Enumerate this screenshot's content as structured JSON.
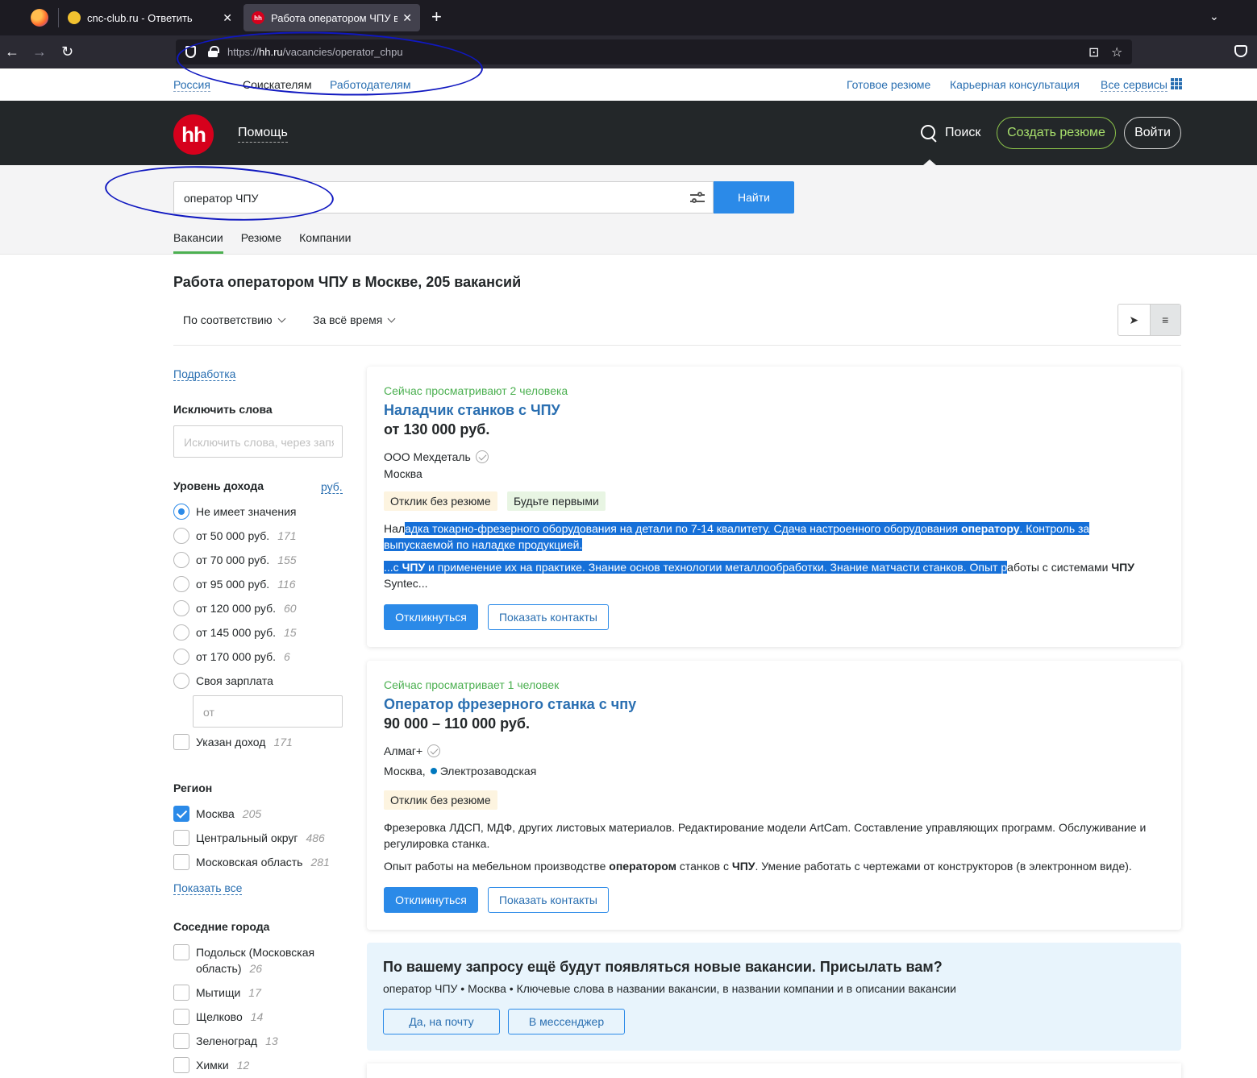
{
  "browser": {
    "tabs": [
      {
        "title": "cnc-club.ru - Ответить",
        "favicon_color": "#f2c230"
      },
      {
        "title": "Работа оператором ЧПУ в Мо",
        "favicon_color": "#d6001c",
        "favicon_text": "hh"
      }
    ],
    "url_scheme": "https://",
    "url_host": "hh.ru",
    "url_path": "/vacancies/operator_chpu"
  },
  "toplinks": {
    "region": "Россия",
    "seekers": "Соискателям",
    "employers": "Работодателям",
    "ready_resume": "Готовое резюме",
    "career": "Карьерная консультация",
    "all_services": "Все сервисы"
  },
  "header": {
    "logo": "hh",
    "help": "Помощь",
    "search": "Поиск",
    "create_resume": "Создать резюме",
    "login": "Войти"
  },
  "search": {
    "query": "оператор ЧПУ",
    "find": "Найти",
    "tabs": [
      "Вакансии",
      "Резюме",
      "Компании"
    ]
  },
  "results": {
    "title": "Работа оператором ЧПУ в Москве, 205 вакансий",
    "sort": "По соответствию",
    "period": "За всё время"
  },
  "sidebar": {
    "podrabotka": "Подработка",
    "exclude_title": "Исключить слова",
    "exclude_placeholder": "Исключить слова, через запятую",
    "income_title": "Уровень дохода",
    "currency": "руб.",
    "income_options": [
      {
        "label": "Не имеет значения",
        "count": ""
      },
      {
        "label": "от 50 000 руб.",
        "count": "171"
      },
      {
        "label": "от 70 000 руб.",
        "count": "155"
      },
      {
        "label": "от 95 000 руб.",
        "count": "116"
      },
      {
        "label": "от 120 000 руб.",
        "count": "60"
      },
      {
        "label": "от 145 000 руб.",
        "count": "15"
      },
      {
        "label": "от 170 000 руб.",
        "count": "6"
      },
      {
        "label": "Своя зарплата",
        "count": ""
      }
    ],
    "own_salary_placeholder": "от",
    "income_specified": {
      "label": "Указан доход",
      "count": "171"
    },
    "region_title": "Регион",
    "regions": [
      {
        "label": "Москва",
        "count": "205"
      },
      {
        "label": "Центральный округ",
        "count": "486"
      },
      {
        "label": "Московская область",
        "count": "281"
      }
    ],
    "show_all": "Показать все",
    "nearby_title": "Соседние города",
    "nearby": [
      {
        "label_line1": "Подольск (Московская",
        "label_line2": "область)",
        "count": "26"
      },
      {
        "label": "Мытищи",
        "count": "17"
      },
      {
        "label": "Щелково",
        "count": "14"
      },
      {
        "label": "Зеленоград",
        "count": "13"
      },
      {
        "label": "Химки",
        "count": "12"
      }
    ]
  },
  "vacancies": [
    {
      "viewing": "Сейчас просматривают 2 человека",
      "title": "Наладчик станков с ЧПУ",
      "salary": "от 130 000 руб.",
      "company": "ООО Мехдеталь",
      "city": "Москва",
      "tags": [
        "Отклик без резюме",
        "Будьте первыми"
      ],
      "snippet1": {
        "a": "Нал",
        "b": "адка токарно-фрезерного оборудования на детали по 7-14 квалитету. Сдача настроенного оборудования ",
        "c": "оператору",
        "d": ". Контроль за ",
        "e": "выпускаемой по наладке продукцией."
      },
      "snippet2": {
        "a": "...с ",
        "b": "ЧПУ",
        "c": " и применение их на практике. Знание основ технологии металлообработки. Знание матчасти станков. Опыт р",
        "d": "аботы с системами ",
        "e": "ЧПУ",
        "f": "Syntec..."
      },
      "respond": "Откликнуться",
      "contacts": "Показать контакты"
    },
    {
      "viewing": "Сейчас просматривает 1 человек",
      "title": "Оператор фрезерного станка с чпу",
      "salary": "90 000 – 110 000 руб.",
      "company": "Алмаг+",
      "city": "Москва,",
      "metro": "Электрозаводская",
      "tags": [
        "Отклик без резюме"
      ],
      "snippet1": {
        "a": "Фрезеровка ЛДСП, МДФ, других листовых материалов. Редактирование модели ArtCam. Составление управляющих программ. Обслуживание и",
        "b": "регулировка станка."
      },
      "snippet2": {
        "a": "Опыт работы на мебельном производстве ",
        "b": "оператором",
        "c": " станков с ",
        "d": "ЧПУ",
        "e": ". Умение работать с чертежами от конструкторов (в электронном виде)."
      },
      "respond": "Откликнуться",
      "contacts": "Показать контакты"
    }
  ],
  "subscribe": {
    "title": "По вашему запросу ещё будут появляться новые вакансии. Присылать вам?",
    "desc": "оператор ЧПУ • Москва • Ключевые слова в названии вакансии, в названии компании и в описании вакансии",
    "email_btn": "Да, на почту",
    "messenger_btn": "В мессенджер"
  }
}
